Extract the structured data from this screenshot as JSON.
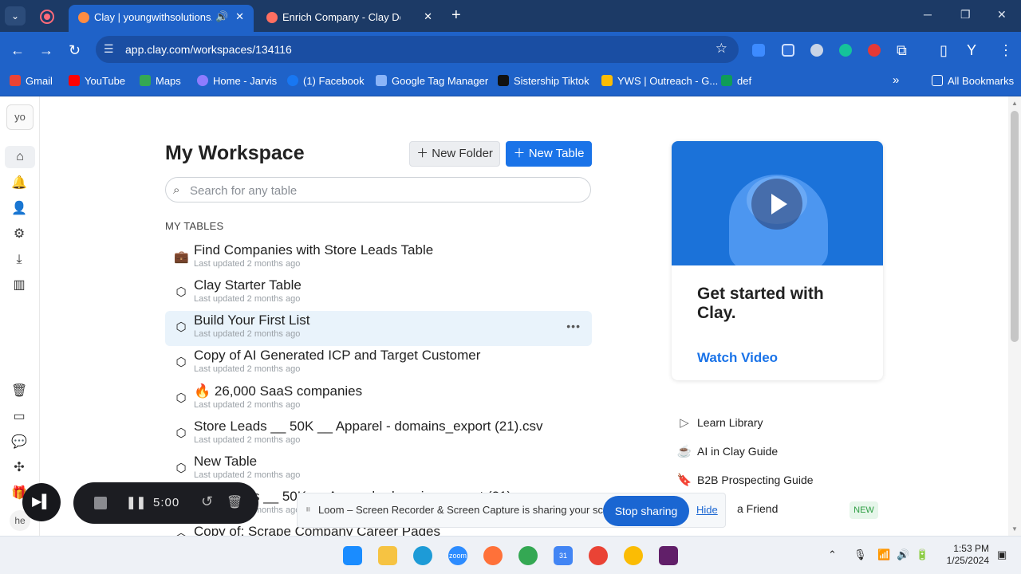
{
  "browser": {
    "tabs": [
      {
        "title": "Clay | youngwithsolutions.c",
        "active": true
      },
      {
        "title": "Enrich Company - Clay Docs",
        "active": false
      }
    ],
    "url": "app.clay.com/workspaces/134116",
    "bookmarks": [
      "Gmail",
      "YouTube",
      "Maps",
      "Home - Jarvis",
      "(1) Facebook",
      "Google Tag Manager",
      "Sistership Tiktok",
      "YWS | Outreach - G...",
      "def"
    ],
    "all_bookmarks": "All Bookmarks",
    "more": "»"
  },
  "sidebar": {
    "workspace_avatar": "yo",
    "user_avatar": "he"
  },
  "workspace": {
    "title": "My Workspace",
    "new_folder": "New Folder",
    "new_table": "New Table",
    "search_placeholder": "Search for any table",
    "section": "MY TABLES",
    "tables": [
      {
        "name": "Find Companies with Store Leads Table",
        "meta": "Last updated 2 months ago",
        "icon": "briefcase-icon"
      },
      {
        "name": "Clay Starter Table",
        "meta": "Last updated 2 months ago",
        "icon": "cube-icon"
      },
      {
        "name": "Build Your First List",
        "meta": "Last updated 2 months ago",
        "icon": "cube-icon"
      },
      {
        "name": "Copy of AI Generated ICP and Target Customer",
        "meta": "Last updated 2 months ago",
        "icon": "cube-icon"
      },
      {
        "name": "🔥 26,000 SaaS companies",
        "meta": "Last updated 2 months ago",
        "icon": "cube-icon"
      },
      {
        "name": "Store Leads __ 50K __ Apparel - domains_export (21).csv",
        "meta": "Last updated 2 months ago",
        "icon": "cube-icon"
      },
      {
        "name": "New Table",
        "meta": "Last updated 2 months ago",
        "icon": "cube-icon"
      },
      {
        "name": "s __ 50K __ Apparel - domains_export (21).csv",
        "meta": "Last updated 2 months ago",
        "icon": "cube-icon"
      },
      {
        "name": "Copy of: Scrape Company Career Pages",
        "meta": "",
        "icon": "cube-icon"
      }
    ]
  },
  "promo": {
    "heading": "Get started with Clay.",
    "link": "Watch Video",
    "resources": [
      "Learn Library",
      "AI in Clay Guide",
      "B2B Prospecting Guide",
      "a Friend"
    ],
    "new_badge": "NEW"
  },
  "loom": {
    "timer": "5:00",
    "share_text": "Loom – Screen Recorder & Screen Capture is sharing your screen.",
    "stop_sharing": "Stop sharing",
    "hide": "Hide"
  },
  "taskbar": {
    "time": "1:53 PM",
    "date": "1/25/2024"
  },
  "colors": {
    "accent": "#1a73e8",
    "chrome": "#1f62c8",
    "tabstrip": "#1c3a66"
  }
}
